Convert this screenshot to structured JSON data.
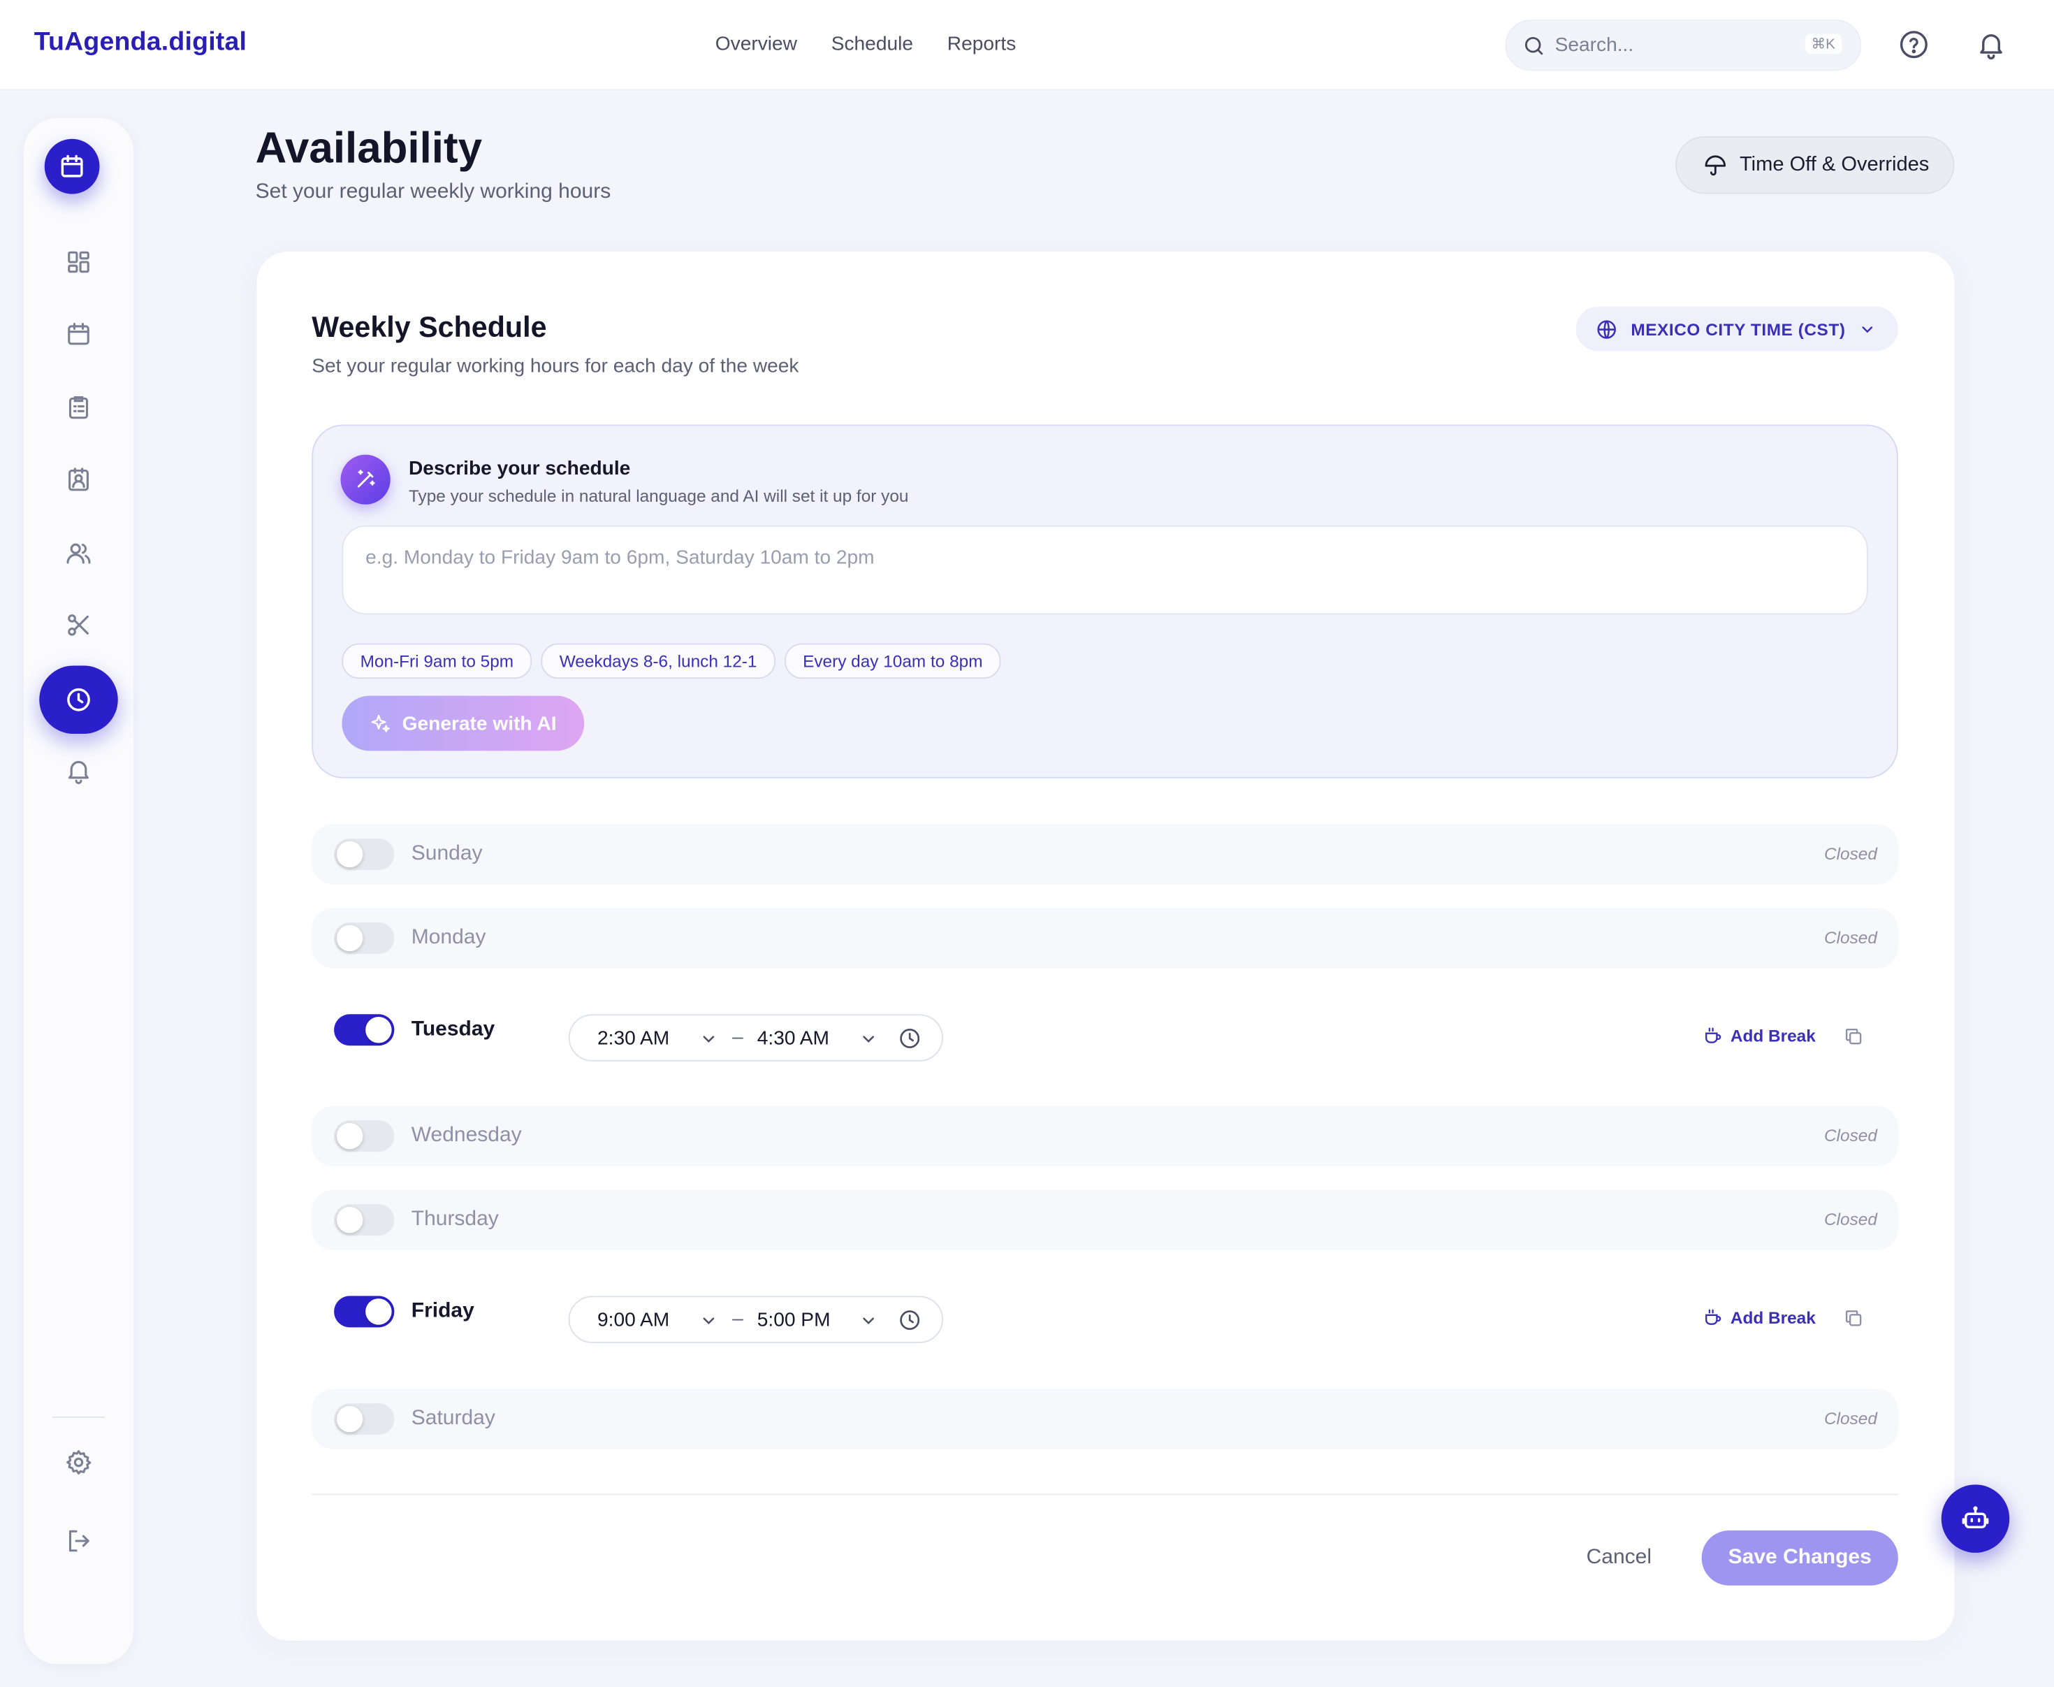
{
  "app": {
    "brand": "TuAgenda.digital"
  },
  "topnav": {
    "items": [
      "Overview",
      "Schedule",
      "Reports"
    ],
    "search_placeholder": "Search...",
    "search_shortcut": "⌘K"
  },
  "page": {
    "title": "Availability",
    "subtitle": "Set your regular weekly working hours",
    "timeoff_label": "Time Off & Overrides"
  },
  "schedule": {
    "title": "Weekly Schedule",
    "subtitle": "Set your regular working hours for each day of the week",
    "timezone": "MEXICO CITY TIME (CST)"
  },
  "ai": {
    "title": "Describe your schedule",
    "subtitle": "Type your schedule in natural language and AI will set it up for you",
    "placeholder": "e.g. Monday to Friday 9am to 6pm, Saturday 10am to 2pm",
    "chips": [
      "Mon-Fri 9am to 5pm",
      "Weekdays 8-6, lunch 12-1",
      "Every day 10am to 8pm"
    ],
    "generate_label": "Generate with AI"
  },
  "days": [
    {
      "name": "Sunday",
      "enabled": false,
      "closed_label": "Closed"
    },
    {
      "name": "Monday",
      "enabled": false,
      "closed_label": "Closed"
    },
    {
      "name": "Tuesday",
      "enabled": true,
      "start": "2:30 AM",
      "end": "4:30 AM",
      "add_break": "Add Break"
    },
    {
      "name": "Wednesday",
      "enabled": false,
      "closed_label": "Closed"
    },
    {
      "name": "Thursday",
      "enabled": false,
      "closed_label": "Closed"
    },
    {
      "name": "Friday",
      "enabled": true,
      "start": "9:00 AM",
      "end": "5:00 PM",
      "add_break": "Add Break"
    },
    {
      "name": "Saturday",
      "enabled": false,
      "closed_label": "Closed"
    }
  ],
  "time_separator": "–",
  "footer": {
    "cancel_label": "Cancel",
    "save_label": "Save Changes"
  },
  "sidebar": {
    "icons": [
      "dashboard-icon",
      "calendar-icon",
      "clipboard-icon",
      "contact-icon",
      "users-icon",
      "scissors-icon",
      "clock-icon",
      "bell-icon",
      "settings-icon",
      "logout-icon"
    ],
    "active": "clock-icon"
  },
  "colors": {
    "brand": "#2a1fc9",
    "accent_text": "#3a30b8",
    "save_button": "#9d95ef"
  }
}
